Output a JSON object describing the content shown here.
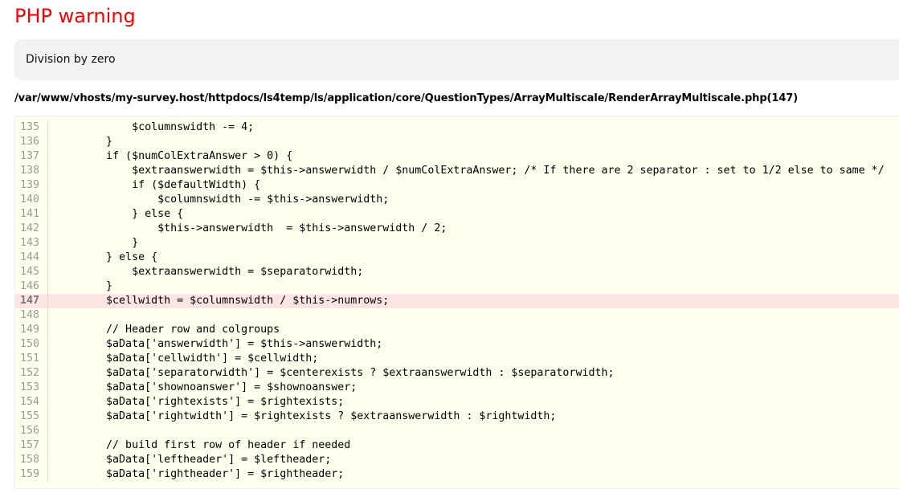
{
  "title": "PHP warning",
  "message": "Division by zero",
  "file": "/var/www/vhosts/my-survey.host/httpdocs/ls4temp/ls/application/core/QuestionTypes/ArrayMultiscale/RenderArrayMultiscale.php(147)",
  "error_line": "147",
  "lines": [
    {
      "n": "135",
      "code": "            $columnswidth -= 4;"
    },
    {
      "n": "136",
      "code": "        }"
    },
    {
      "n": "137",
      "code": "        if ($numColExtraAnswer > 0) {"
    },
    {
      "n": "138",
      "code": "            $extraanswerwidth = $this->answerwidth / $numColExtraAnswer; /* If there are 2 separator : set to 1/2 else to same */"
    },
    {
      "n": "139",
      "code": "            if ($defaultWidth) {"
    },
    {
      "n": "140",
      "code": "                $columnswidth -= $this->answerwidth;"
    },
    {
      "n": "141",
      "code": "            } else {"
    },
    {
      "n": "142",
      "code": "                $this->answerwidth  = $this->answerwidth / 2;"
    },
    {
      "n": "143",
      "code": "            }"
    },
    {
      "n": "144",
      "code": "        } else {"
    },
    {
      "n": "145",
      "code": "            $extraanswerwidth = $separatorwidth;"
    },
    {
      "n": "146",
      "code": "        }"
    },
    {
      "n": "147",
      "code": "        $cellwidth = $columnswidth / $this->numrows;"
    },
    {
      "n": "148",
      "code": ""
    },
    {
      "n": "149",
      "code": "        // Header row and colgroups"
    },
    {
      "n": "150",
      "code": "        $aData['answerwidth'] = $this->answerwidth;"
    },
    {
      "n": "151",
      "code": "        $aData['cellwidth'] = $cellwidth;"
    },
    {
      "n": "152",
      "code": "        $aData['separatorwidth'] = $centerexists ? $extraanswerwidth : $separatorwidth;"
    },
    {
      "n": "153",
      "code": "        $aData['shownoanswer'] = $shownoanswer;"
    },
    {
      "n": "154",
      "code": "        $aData['rightexists'] = $rightexists;"
    },
    {
      "n": "155",
      "code": "        $aData['rightwidth'] = $rightexists ? $extraanswerwidth : $rightwidth;"
    },
    {
      "n": "156",
      "code": ""
    },
    {
      "n": "157",
      "code": "        // build first row of header if needed"
    },
    {
      "n": "158",
      "code": "        $aData['leftheader'] = $leftheader;"
    },
    {
      "n": "159",
      "code": "        $aData['rightheader'] = $rightheader;"
    }
  ]
}
